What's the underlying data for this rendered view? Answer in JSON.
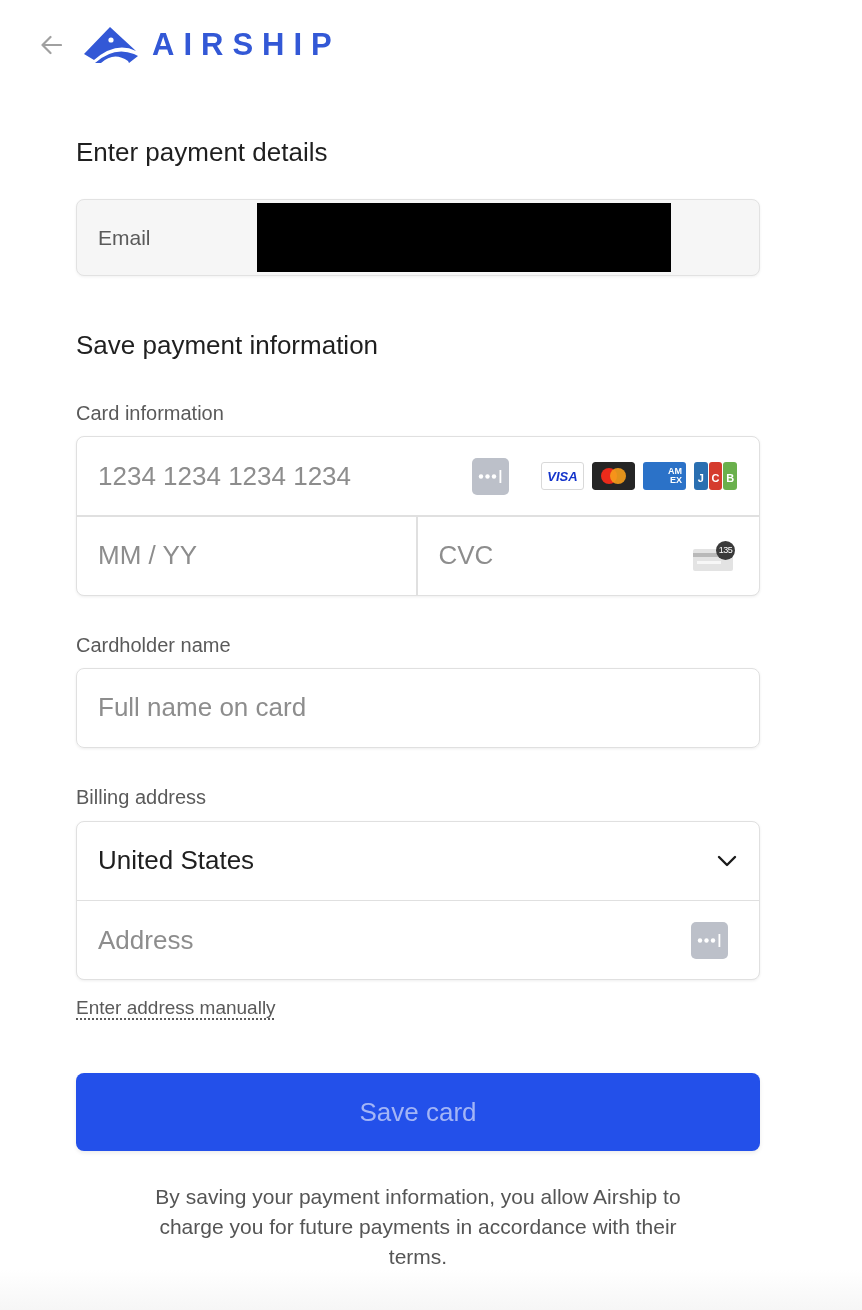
{
  "header": {
    "logo_text": "AIRSHIP"
  },
  "payment_details": {
    "title": "Enter payment details",
    "email": {
      "label": "Email",
      "value_redacted": true
    }
  },
  "save_section": {
    "title": "Save payment information"
  },
  "card_information": {
    "label": "Card information",
    "number": {
      "placeholder": "1234 1234 1234 1234"
    },
    "brands": [
      {
        "kind": "visa",
        "label": "VISA"
      },
      {
        "kind": "mastercard"
      },
      {
        "kind": "amex",
        "label_lines": [
          "AM",
          "EX"
        ]
      },
      {
        "kind": "jcb",
        "letters": [
          "J",
          "C",
          "B"
        ]
      }
    ],
    "expiry": {
      "placeholder": "MM / YY"
    },
    "cvc": {
      "placeholder": "CVC",
      "icon_badge": "135"
    }
  },
  "cardholder_name": {
    "label": "Cardholder name",
    "placeholder": "Full name on card"
  },
  "billing_address": {
    "label": "Billing address",
    "country": {
      "value": "United States"
    },
    "address": {
      "placeholder": "Address"
    },
    "manual_link": "Enter address manually"
  },
  "save_button": {
    "label": "Save card",
    "disabled": true
  },
  "footer_note": "By saving your payment information, you allow Airship to charge you for future payments in accordance with their terms."
}
